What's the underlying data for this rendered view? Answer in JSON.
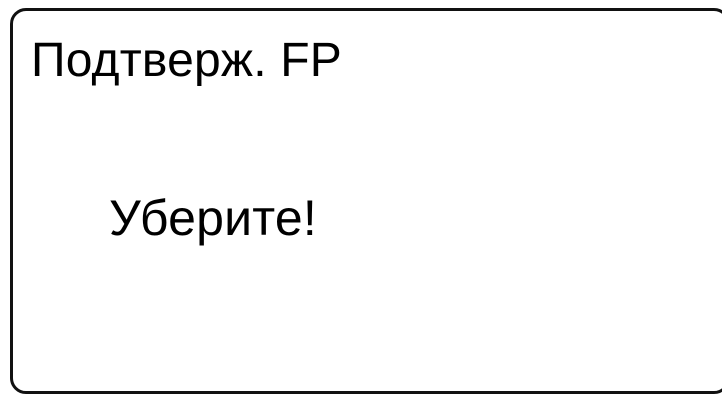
{
  "screen": {
    "title": "Подтверж. FP",
    "message": "Уберите!"
  },
  "colors": {
    "background": "#ffffff",
    "border": "#111111",
    "text": "#000000"
  }
}
